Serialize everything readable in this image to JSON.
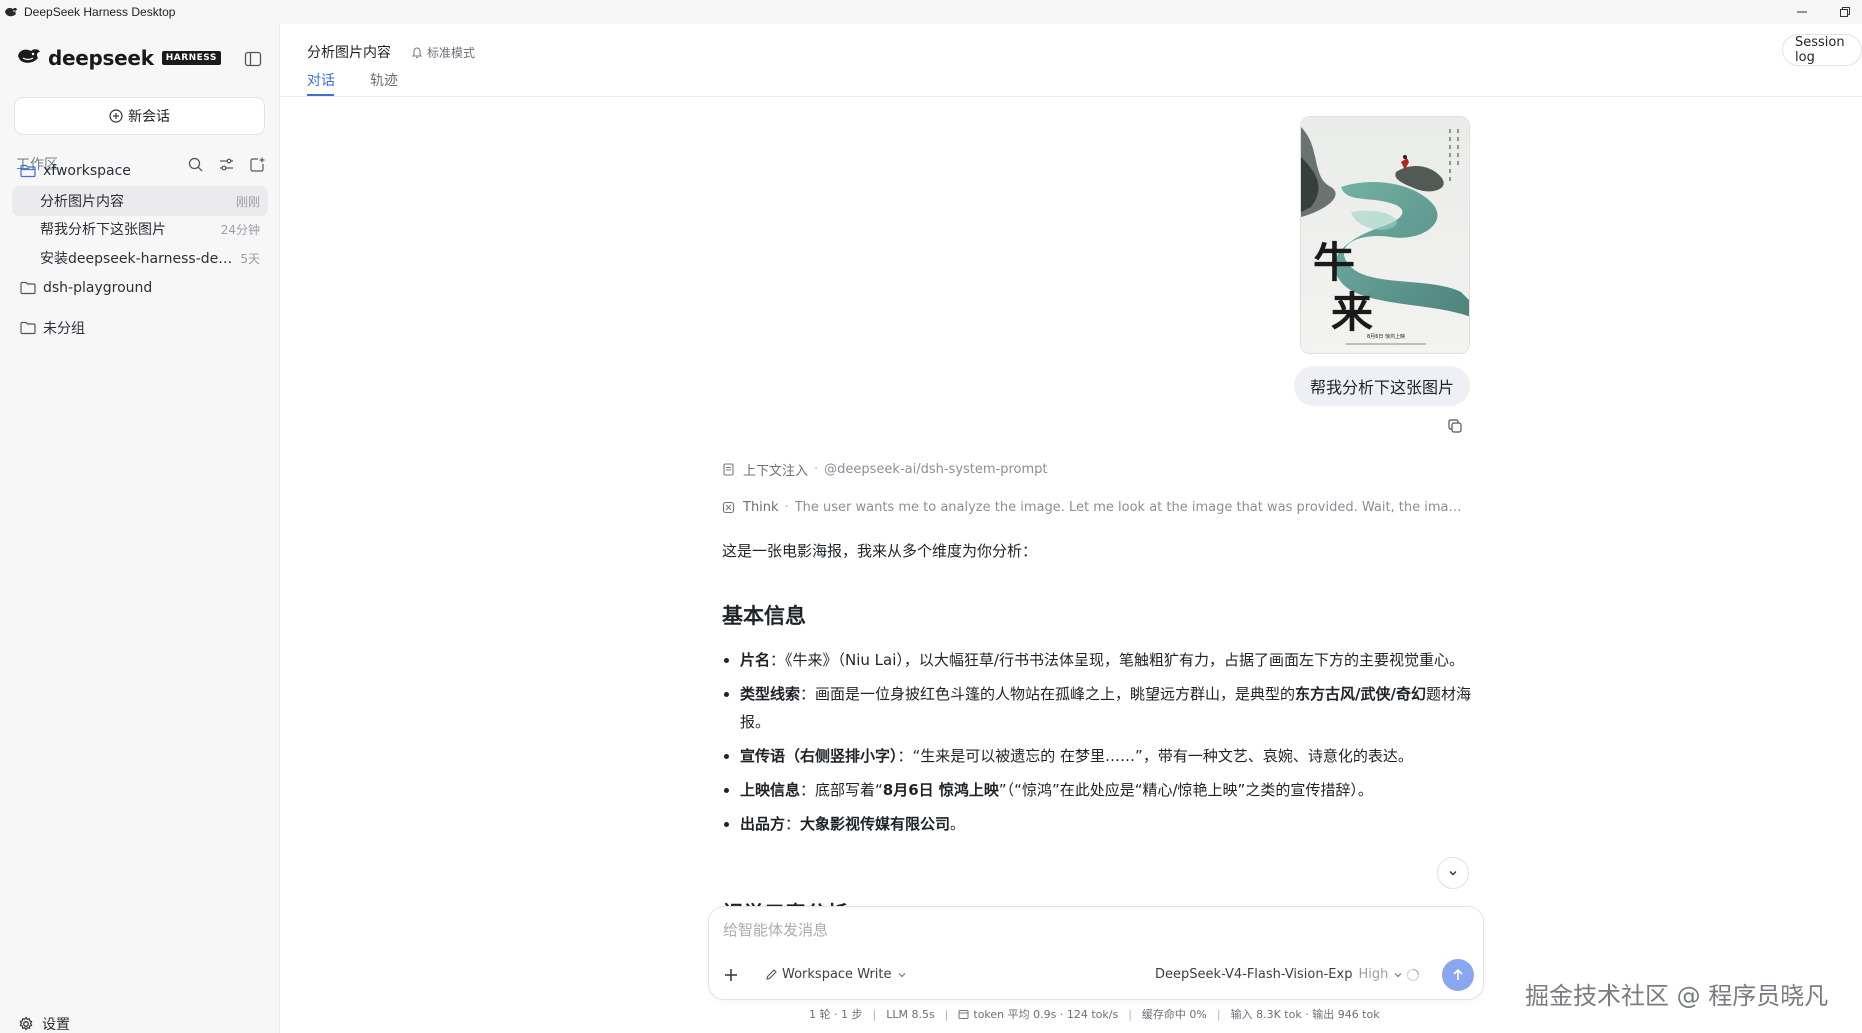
{
  "app": {
    "title": "DeepSeek Harness Desktop"
  },
  "sidebar": {
    "brand": "deepseek",
    "brand_badge": "HARNESS",
    "new_chat_label": "新会话",
    "workspace_label": "工作区",
    "folders": [
      {
        "name": "xfworkspace",
        "items": [
          {
            "name": "分析图片内容",
            "time": "刚刚",
            "active": true
          },
          {
            "name": "帮我分析下这张图片",
            "time": "24分钟"
          },
          {
            "name": "安装deepseek-harness-deskt...",
            "time": "5天"
          }
        ]
      },
      {
        "name": "dsh-playground"
      },
      {
        "name": "未分组"
      }
    ],
    "settings_label": "设置"
  },
  "header": {
    "conversation_title": "分析图片内容",
    "mode_label": "标准模式",
    "tabs": [
      {
        "label": "对话",
        "active": true
      },
      {
        "label": "轨迹"
      }
    ],
    "session_log_label": "Session log"
  },
  "chat": {
    "user_message": "帮我分析下这张图片",
    "poster": {
      "title_chars": [
        "牛",
        "来"
      ],
      "bottom_text": "8月6日 惊鸿上映"
    },
    "context_label": "上下文注入",
    "context_value": "@deepseek-ai/dsh-system-prompt",
    "think_label": "Think",
    "think_text": "The user wants me to analyze the image. Let me look at the image that was provided. Wait, the image was ...",
    "answer": {
      "intro": "这是一张电影海报，我来从多个维度为你分析：",
      "heading": "基本信息",
      "bullets": [
        {
          "label": "片名",
          "text": "：《牛来》（Niu Lai），以大幅狂草/行书书法体呈现，笔触粗犷有力，占据了画面左下方的主要视觉重心。"
        },
        {
          "label": "类型线索",
          "text_a": "：画面是一位身披红色斗篷的人物站在孤峰之上，眺望远方群山，是典型的",
          "bold_mid": "东方古风/武侠/奇幻",
          "text_b": "题材海报。"
        },
        {
          "label": "宣传语（右侧竖排小字）",
          "text": "：“生来是可以被遗忘的 在梦里……”，带有一种文艺、哀婉、诗意化的表达。"
        },
        {
          "label": "上映信息",
          "text_a": "：底部写着“",
          "bold_mid": "8月6日 惊鸿上映",
          "text_b": "”（“惊鸿”在此处应是“精心/惊艳上映”之类的宣传措辞）。"
        },
        {
          "label": "出品方",
          "text_a": "：",
          "bold_mid": "大象影视传媒有限公司",
          "text_b": "。"
        }
      ],
      "cut_heading": "视觉元素分析"
    }
  },
  "composer": {
    "placeholder": "给智能体发消息",
    "workspace_mode": "Workspace Write",
    "model": "DeepSeek-V4-Flash-Vision-Exp",
    "effort": "High"
  },
  "status": {
    "turns": "1 轮 · 1 步",
    "llm": "LLM 8.5s",
    "token": "token 平均 0.9s · 124 tok/s",
    "cache": "缓存命中 0%",
    "io": "输入 8.3K tok · 输出 946 tok"
  },
  "watermark": "掘金技术社区 @ 程序员晓凡",
  "colors": {
    "accent": "#3b6fd9",
    "send_button": "#8aa6f0",
    "sidebar_bg": "#f7f7f8"
  }
}
